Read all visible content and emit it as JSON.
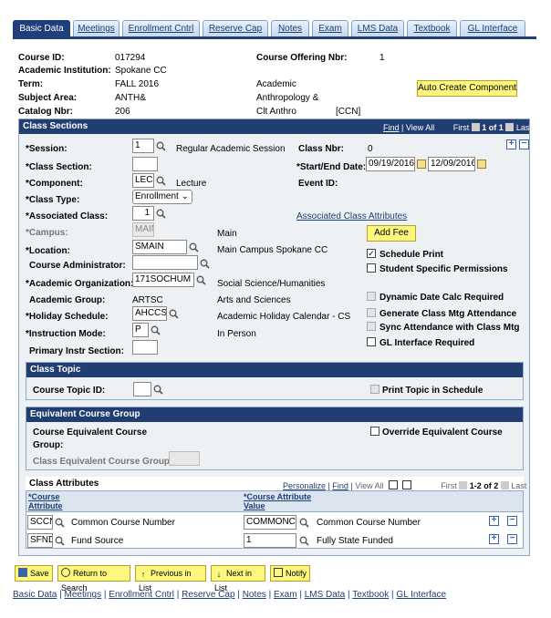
{
  "tabs": [
    {
      "label": "Basic Data",
      "active": true
    },
    {
      "label": "Meetings"
    },
    {
      "label": "Enrollment Cntrl"
    },
    {
      "label": "Reserve Cap"
    },
    {
      "label": "Notes"
    },
    {
      "label": "Exam"
    },
    {
      "label": "LMS Data"
    },
    {
      "label": "Textbook"
    },
    {
      "label": "GL Interface"
    }
  ],
  "course": {
    "course_id_label": "Course ID:",
    "course_id": "017294",
    "offering_label": "Course Offering Nbr:",
    "offering": "1",
    "institution_label": "Academic Institution:",
    "institution": "Spokane CC",
    "term_label": "Term:",
    "term": "FALL 2016",
    "subject_label": "Subject Area:",
    "subject": "ANTH&",
    "catalog_label": "Catalog Nbr:",
    "catalog": "206",
    "title_line1": "Academic",
    "title_line2": "Anthropology &",
    "title_line3": "Clt Anthro",
    "title_tag": "[CCN]",
    "auto_create_button": "Auto Create Component"
  },
  "class_sections": {
    "header": "Class Sections",
    "nav": {
      "find": "Find",
      "view_all": "View All",
      "first": "First",
      "range": "1 of 1",
      "last": "Last"
    },
    "session_label": "*Session:",
    "session": "1",
    "session_desc": "Regular Academic Session",
    "class_nbr_label": "Class Nbr:",
    "class_nbr": "0",
    "class_section_label": "*Class Section:",
    "class_section": "",
    "start_end_label": "*Start/End Date:",
    "start_date": "09/19/2016",
    "end_date": "12/09/2016",
    "component_label": "*Component:",
    "component": "LEC",
    "component_desc": "Lecture",
    "event_id_label": "Event ID:",
    "class_type_label": "*Class Type:",
    "class_type": "Enrollment",
    "associated_class_label": "*Associated Class:",
    "associated_class": "1",
    "associated_attr_link": "Associated Class Attributes",
    "campus_label": "*Campus:",
    "campus": "MAIN",
    "campus_desc": "Main",
    "add_fee_button": "Add Fee",
    "location_label": "*Location:",
    "location": "SMAIN",
    "location_desc": "Main Campus Spokane CC",
    "schedule_print_label": "Schedule Print",
    "course_admin_label": "Course Administrator:",
    "course_admin": "",
    "student_perm_label": "Student Specific Permissions",
    "acad_org_label": "*Academic Organization:",
    "acad_org": "171SOCHUM",
    "acad_org_desc": "Social Science/Humanities",
    "dyn_date_label": "Dynamic Date Calc Required",
    "acad_group_label": "Academic Group:",
    "acad_group": "ARTSC",
    "acad_group_desc": "Arts and Sciences",
    "gen_mtg_label": "Generate Class Mtg Attendance",
    "holiday_label": "*Holiday Schedule:",
    "holiday": "AHCCS",
    "holiday_desc": "Academic Holiday Calendar - CS",
    "sync_label": "Sync Attendance with Class Mtg",
    "instr_mode_label": "*Instruction Mode:",
    "instr_mode": "P",
    "instr_mode_desc": "In Person",
    "gl_label": "GL Interface Required",
    "primary_instr_label": "Primary Instr Section:",
    "primary_instr": ""
  },
  "class_topic": {
    "header": "Class Topic",
    "course_topic_label": "Course Topic ID:",
    "print_topic_label": "Print Topic in Schedule"
  },
  "equivalent": {
    "header": "Equivalent Course Group",
    "group_label_1": "Course Equivalent Course",
    "group_label_2": "Group:",
    "override_label": "Override Equivalent Course",
    "class_equiv_label": "Class Equivalent Course Group:"
  },
  "attributes": {
    "header": "Class Attributes",
    "nav": {
      "personalize": "Personalize",
      "find": "Find",
      "view_all": "View All",
      "first": "First",
      "range": "1-2 of 2",
      "last": "Last"
    },
    "col1_line1": "*Course",
    "col1_line2": "Attribute",
    "col3_line1": "*Course Attribute",
    "col3_line2": "Value",
    "rows": [
      {
        "attr": "SCCN",
        "attr_desc": "Common Course Number",
        "value": "COMMONCRS",
        "value_desc": "Common Course Number"
      },
      {
        "attr": "SFND",
        "attr_desc": "Fund Source",
        "value": "1",
        "value_desc": "Fully State Funded"
      }
    ]
  },
  "toolbar": {
    "save": "Save",
    "return": "Return to Search",
    "prev": "Previous in List",
    "next": "Next in List",
    "notify": "Notify"
  },
  "footer_links": [
    "Basic Data",
    "Meetings",
    "Enrollment Cntrl",
    "Reserve Cap",
    "Notes",
    "Exam",
    "LMS Data",
    "Textbook",
    "GL Interface"
  ]
}
